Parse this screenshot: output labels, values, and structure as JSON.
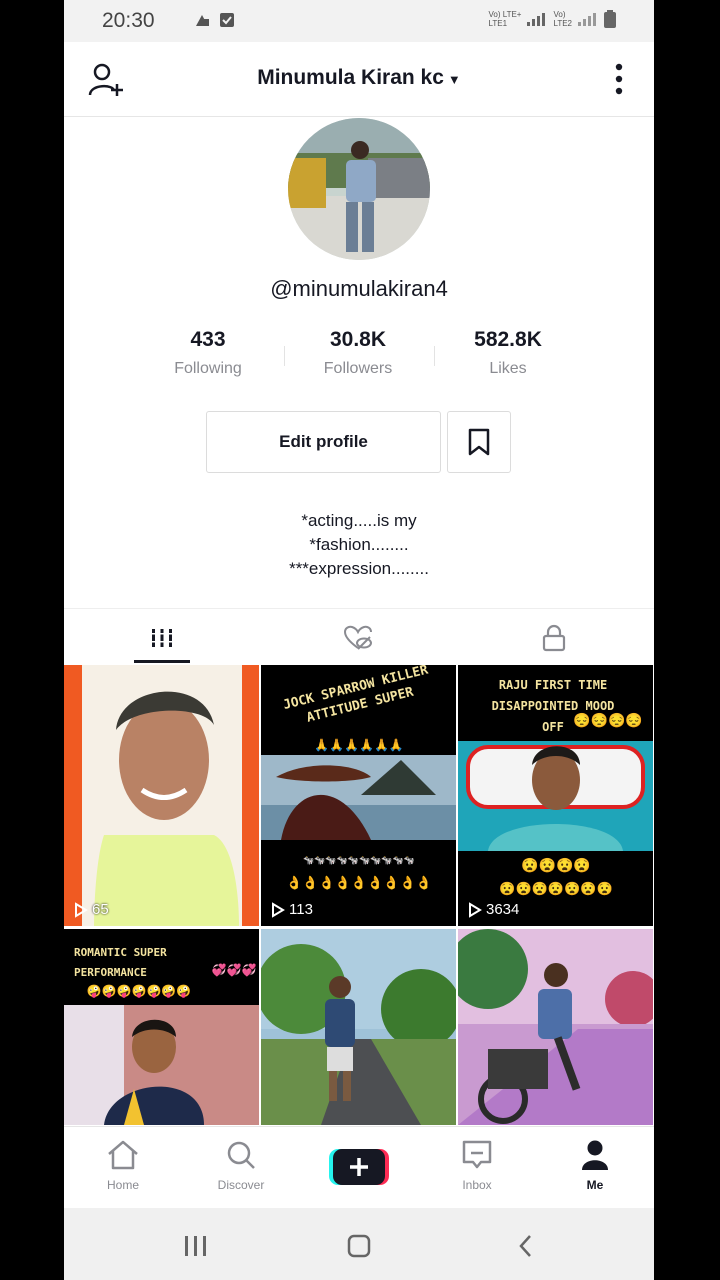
{
  "status": {
    "time": "20:30",
    "net1": "Vo) LTE+\nLTE1",
    "net2": "Vo)\nLTE2"
  },
  "header": {
    "title": "Minumula Kiran kc"
  },
  "profile": {
    "handle": "@minumulakiran4",
    "stats": [
      {
        "value": "433",
        "label": "Following"
      },
      {
        "value": "30.8K",
        "label": "Followers"
      },
      {
        "value": "582.8K",
        "label": "Likes"
      }
    ],
    "edit_label": "Edit profile",
    "bio": [
      "*acting.....is my",
      "*fashion........",
      "***expression........"
    ]
  },
  "videos": [
    {
      "views": "65",
      "caption": ""
    },
    {
      "views": "113",
      "caption": "JOCK SPARROW KILLER ATTITUDE SUPER"
    },
    {
      "views": "3634",
      "caption": "RAJU FIRST TIME DISAPPOINTED MOOD OFF"
    },
    {
      "views": "",
      "caption": "ROMANTIC SUPER PERFORMANCE"
    },
    {
      "views": "",
      "caption": ""
    },
    {
      "views": "",
      "caption": ""
    }
  ],
  "nav": {
    "home": "Home",
    "discover": "Discover",
    "inbox": "Inbox",
    "me": "Me"
  },
  "colors": {
    "accent_cyan": "#25f4ee",
    "accent_red": "#fe2c55",
    "text": "#161823",
    "muted": "#8a8b91"
  }
}
